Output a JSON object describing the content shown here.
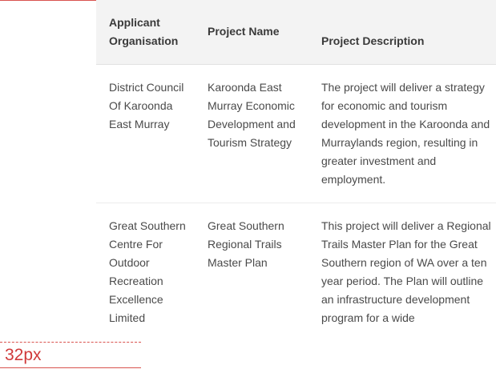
{
  "annotation": {
    "label": "32px"
  },
  "table": {
    "headers": [
      "Applicant Organisation",
      "Project Name",
      "Project Description"
    ],
    "rows": [
      {
        "organisation": "District Council Of Karoonda East Murray",
        "project_name": "Karoonda East Murray Economic Development and Tourism Strategy",
        "description": "The project will deliver a strategy for economic and tourism development in the Karoonda and Murraylands region, resulting in greater investment and employment."
      },
      {
        "organisation": "Great Southern Centre For Outdoor Recreation Excellence Limited",
        "project_name": "Great Southern Regional Trails Master Plan",
        "description": "This project will deliver a Regional Trails Master Plan for the Great Southern region of WA over a ten year period. The Plan will outline an infrastructure development program for a wide"
      }
    ]
  },
  "colors": {
    "annotation_red": "#d0393a",
    "header_background": "#f3f3f3",
    "text": "#444444"
  }
}
